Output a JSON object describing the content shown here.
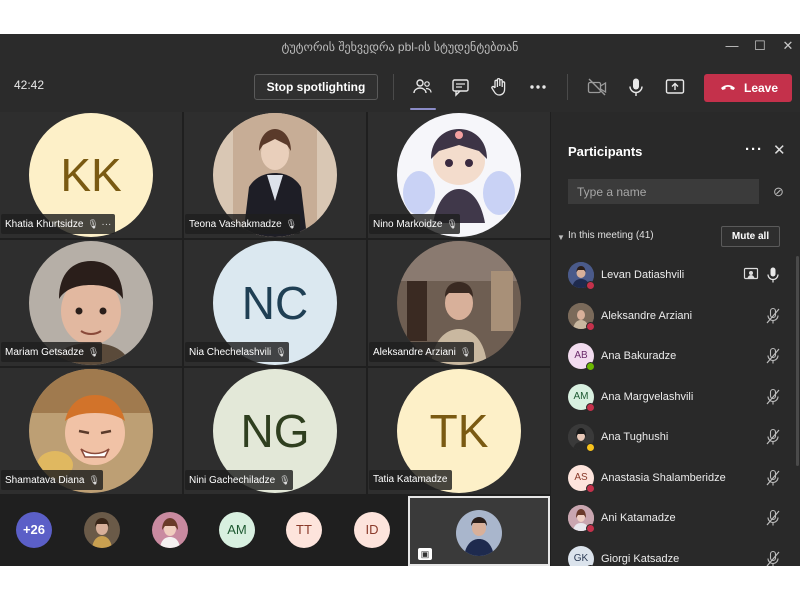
{
  "window": {
    "title": "ტუტორის შეხვედრა pbl-ის სტუდენტებთან"
  },
  "toolbar": {
    "timer": "42:42",
    "stop_spotlight_label": "Stop spotlighting",
    "leave_label": "Leave"
  },
  "grid": {
    "tiles": [
      {
        "name": "Khatia Khurtsidze",
        "initials": "KK",
        "bg": "#fdf0c8",
        "fg": "#7a5a12",
        "more": "···"
      },
      {
        "name": "Teona Vashakmadze",
        "initials": "",
        "bg": "#c9b8a6",
        "fg": "#333"
      },
      {
        "name": "Nino Markoidze",
        "initials": "",
        "bg": "#f4f4f8",
        "fg": "#333"
      },
      {
        "name": "Mariam Getsadze",
        "initials": "",
        "bg": "#b8b0a6",
        "fg": "#333"
      },
      {
        "name": "Nia Chechelashvili",
        "initials": "NC",
        "bg": "#dbe8f0",
        "fg": "#1f3f54"
      },
      {
        "name": "Aleksandre Arziani",
        "initials": "",
        "bg": "#8a7a6a",
        "fg": "#333"
      },
      {
        "name": "Shamatava Diana",
        "initials": "",
        "bg": "#c0a070",
        "fg": "#333"
      },
      {
        "name": "Nini Gachechiladze",
        "initials": "NG",
        "bg": "#e3e8d8",
        "fg": "#2f3f1f"
      },
      {
        "name": "Tatia Katamadze",
        "initials": "TK",
        "bg": "#fdf0c8",
        "fg": "#7a5a12"
      }
    ]
  },
  "strip": {
    "overflow_count": "+26",
    "avatars": [
      {
        "initials": "",
        "bg": "#8a6a4a",
        "fg": "#333"
      },
      {
        "initials": "",
        "bg": "#b07a8a",
        "fg": "#333"
      },
      {
        "initials": "AM",
        "bg": "#d8f0e0",
        "fg": "#1e5a32"
      },
      {
        "initials": "TT",
        "bg": "#fde4dc",
        "fg": "#8a3a2a"
      },
      {
        "initials": "ID",
        "bg": "#fde4dc",
        "fg": "#8a3a2a"
      }
    ]
  },
  "panel": {
    "title": "Participants",
    "search_placeholder": "Type a name",
    "section_label": "In this meeting (41)",
    "mute_all_label": "Mute all",
    "participants": [
      {
        "name": "Levan Datiashvili",
        "initials": "",
        "bg": "#4a5a8a",
        "fg": "#fff",
        "status": "#c4314b",
        "mic": "on",
        "presenter": true
      },
      {
        "name": "Aleksandre Arziani",
        "initials": "",
        "bg": "#7a6a5a",
        "fg": "#fff",
        "status": "#c4314b",
        "mic": "muted"
      },
      {
        "name": "Ana Bakuradze",
        "initials": "AB",
        "bg": "#f2dcef",
        "fg": "#6a2a6a",
        "status": "#6bb700",
        "mic": "muted"
      },
      {
        "name": "Ana Margvelashvili",
        "initials": "AM",
        "bg": "#d8f0e0",
        "fg": "#1e5a32",
        "status": "#c4314b",
        "mic": "muted"
      },
      {
        "name": "Ana Tughushi",
        "initials": "",
        "bg": "#3a3a3a",
        "fg": "#fff",
        "status": "#f8c21c",
        "mic": "muted"
      },
      {
        "name": "Anastasia Shalamberidze",
        "initials": "AS",
        "bg": "#fde4dc",
        "fg": "#8a3a2a",
        "status": "#c4314b",
        "mic": "muted"
      },
      {
        "name": "Ani Katamadze",
        "initials": "",
        "bg": "#c9a6b0",
        "fg": "#fff",
        "status": "#c4314b",
        "mic": "muted"
      },
      {
        "name": "Giorgi Katsadze",
        "initials": "GK",
        "bg": "#dbe3ec",
        "fg": "#2a3a54",
        "status": "#c4314b",
        "mic": "muted"
      }
    ]
  }
}
